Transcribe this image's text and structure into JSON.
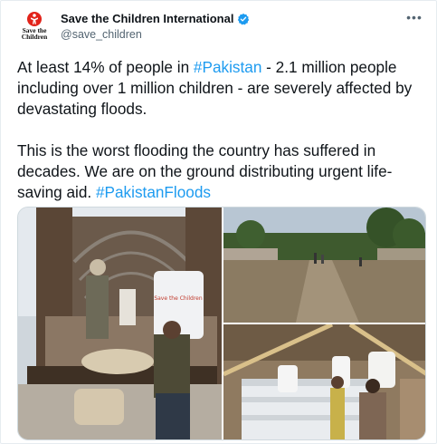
{
  "account": {
    "display_name": "Save the Children International",
    "handle": "@save_children",
    "verified": true,
    "avatar_logo_text": "Save the Children",
    "brand_color": "#e2231a"
  },
  "menu": {
    "more_icon": "ellipsis-icon",
    "more_glyph": "•••"
  },
  "tweet": {
    "p1_pre": "At least 14% of people in ",
    "p1_tag": "#Pakistan",
    "p1_post": " - 2.1 million people including over 1 million children - are severely affected by devastating floods.",
    "p2_pre": "This is the worst flooding the country has suffered in decades. We are on the ground distributing urgent life-saving aid. ",
    "p2_tag": "#PakistanFloods",
    "link_color": "#1d9bf0"
  },
  "media": [
    {
      "name": "aid-truck-unloading-photo",
      "sack_print": "Save the Children"
    },
    {
      "name": "flooded-street-photo"
    },
    {
      "name": "aid-sacks-warehouse-photo"
    }
  ]
}
